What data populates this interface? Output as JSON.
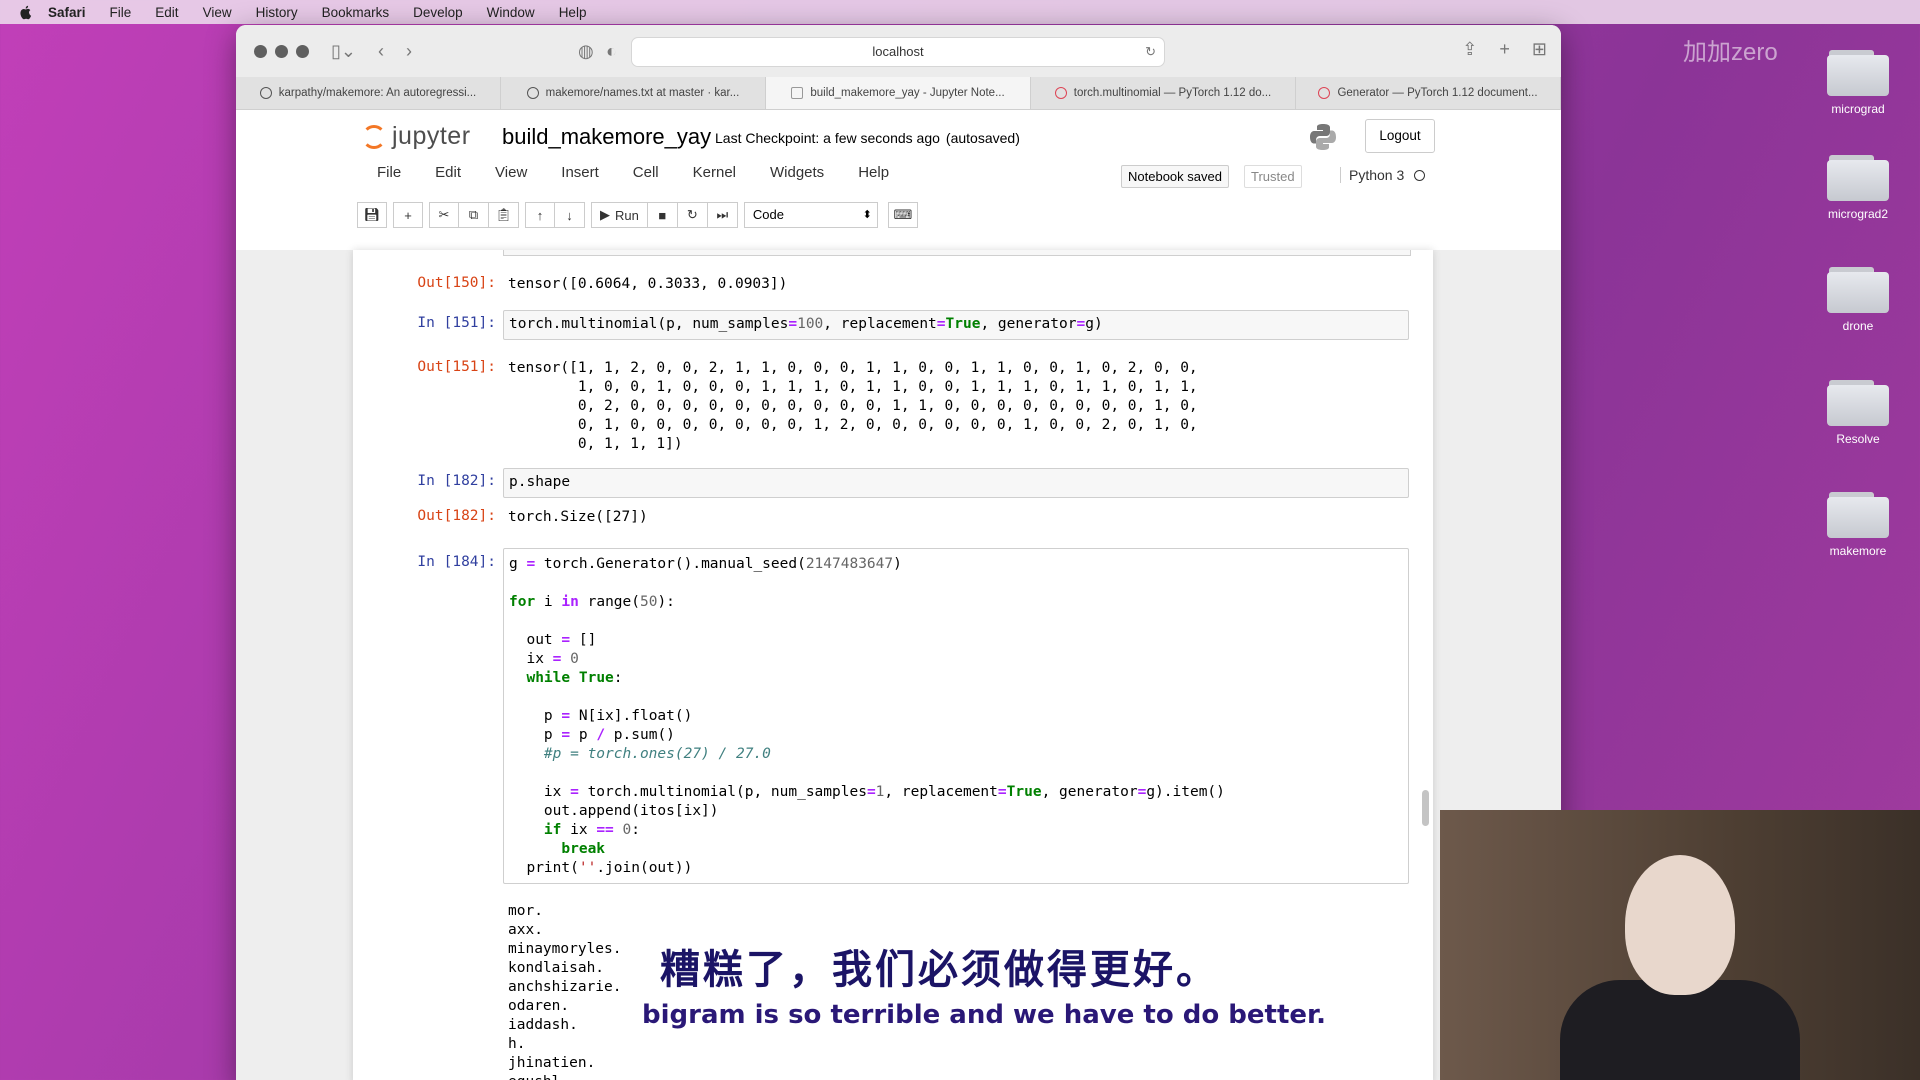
{
  "os_menubar": {
    "items": [
      "Safari",
      "File",
      "Edit",
      "View",
      "History",
      "Bookmarks",
      "Develop",
      "Window",
      "Help"
    ]
  },
  "desktop": {
    "watermark": "加加zero",
    "folders": [
      "micrograd",
      "micrograd2",
      "drone",
      "Resolve",
      "makemore"
    ]
  },
  "browser": {
    "url": "localhost",
    "tabs": [
      {
        "label": "karpathy/makemore: An autoregressi...",
        "icon": "github-icon"
      },
      {
        "label": "makemore/names.txt at master · kar...",
        "icon": "github-icon"
      },
      {
        "label": "build_makemore_yay - Jupyter Note...",
        "icon": "jupyter-icon",
        "active": true
      },
      {
        "label": "torch.multinomial — PyTorch 1.12 do...",
        "icon": "pytorch-icon"
      },
      {
        "label": "Generator — PyTorch 1.12 document...",
        "icon": "pytorch-icon"
      }
    ]
  },
  "jupyter": {
    "logo_text": "jupyter",
    "notebook_name": "build_makemore_yay",
    "checkpoint": "Last Checkpoint: a few seconds ago",
    "autosaved": "(autosaved)",
    "logout": "Logout",
    "menu": [
      "File",
      "Edit",
      "View",
      "Insert",
      "Cell",
      "Kernel",
      "Widgets",
      "Help"
    ],
    "notebook_saved": "Notebook saved",
    "trusted": "Trusted",
    "kernel_name": "Python 3",
    "run_label": "Run",
    "cell_type": "Code"
  },
  "cells": {
    "out150": {
      "prompt": "Out[150]:",
      "text": "tensor([0.6064, 0.3033, 0.0903])"
    },
    "in151": {
      "prompt": "In [151]:"
    },
    "out151": {
      "prompt": "Out[151]:",
      "text": "tensor([1, 1, 2, 0, 0, 2, 1, 1, 0, 0, 0, 1, 1, 0, 0, 1, 1, 0, 0, 1, 0, 2, 0, 0,\n        1, 0, 0, 1, 0, 0, 0, 1, 1, 1, 0, 1, 1, 0, 0, 1, 1, 1, 0, 1, 1, 0, 1, 1,\n        0, 2, 0, 0, 0, 0, 0, 0, 0, 0, 0, 0, 1, 1, 0, 0, 0, 0, 0, 0, 0, 0, 1, 0,\n        0, 1, 0, 0, 0, 0, 0, 0, 0, 1, 2, 0, 0, 0, 0, 0, 0, 1, 0, 0, 2, 0, 1, 0,\n        0, 1, 1, 1])"
    },
    "in182": {
      "prompt": "In [182]:",
      "code": "p.shape"
    },
    "out182": {
      "prompt": "Out[182]:",
      "text": "torch.Size([27])"
    },
    "in184": {
      "prompt": "In [184]:"
    },
    "out184": {
      "text": "mor.\naxx.\nminaymoryles.\nkondlaisah.\nanchshizarie.\nodaren.\niaddash.\nh.\njhinatien.\negushl.\nh."
    }
  },
  "subtitles": {
    "chinese": "糟糕了，我们必须做得更好。",
    "english": "bigram is so terrible and we have to do better."
  }
}
